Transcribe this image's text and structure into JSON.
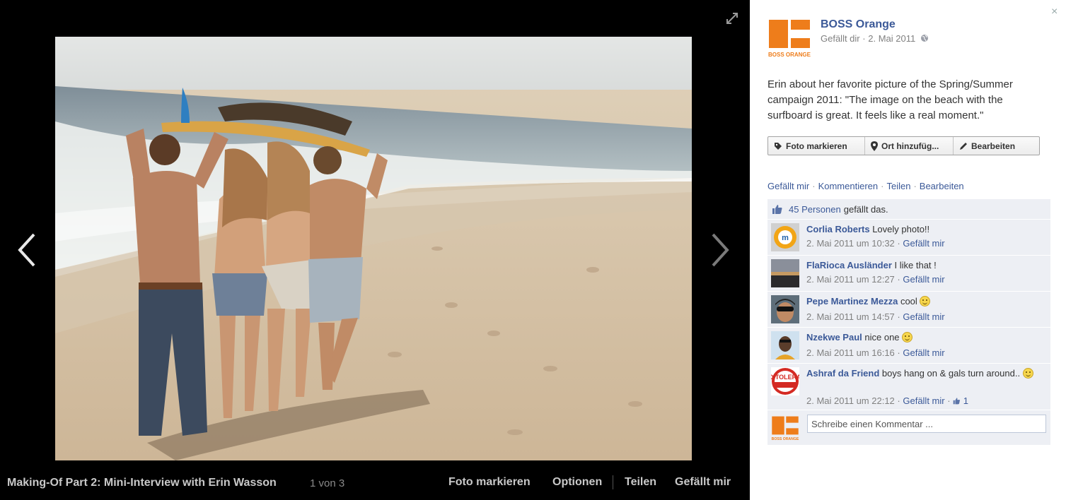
{
  "viewer": {
    "caption": "Making-Of Part 2: Mini-Interview with Erin Wasson",
    "counter": "1 von 3",
    "actions": {
      "tag": "Foto markieren",
      "options": "Optionen",
      "share": "Teilen",
      "like": "Gefällt mir"
    }
  },
  "sidebar": {
    "close": "×",
    "page": {
      "logo_text": "BOSS ORANGE",
      "name": "BOSS Orange",
      "likes_label": "Gefällt dir",
      "sep": "·",
      "date": "2. Mai 2011"
    },
    "description": "Erin about her favorite picture of the Spring/Summer campaign 2011: \"The image on the beach with the surfboard is great. It feels like a real moment.\"",
    "toolbar": {
      "tag": "Foto markieren",
      "location": "Ort hinzufüg...",
      "edit": "Bearbeiten"
    },
    "actions": {
      "like": "Gefällt mir",
      "comment": "Kommentieren",
      "share": "Teilen",
      "edit": "Bearbeiten",
      "sep": "·"
    },
    "likes": {
      "count": "45 Personen",
      "suffix": "gefällt das."
    },
    "comments": [
      {
        "author": "Corlia Roberts",
        "text": "Lovely photo!!",
        "time": "2. Mai 2011 um 10:32",
        "like": "Gefällt mir"
      },
      {
        "author": "FlaRioca Ausländer",
        "text": "I like that !",
        "time": "2. Mai 2011 um 12:27",
        "like": "Gefällt mir"
      },
      {
        "author": "Pepe Martinez Mezza",
        "text": "cool",
        "time": "2. Mai 2011 um 14:57",
        "like": "Gefällt mir",
        "smiley": true
      },
      {
        "author": "Nzekwe Paul",
        "text": "nice one",
        "time": "2. Mai 2011 um 16:16",
        "like": "Gefällt mir",
        "smiley": true
      },
      {
        "author": "Ashraf da Friend",
        "text": "boys hang on & gals turn around..",
        "time": "2. Mai 2011 um 22:12",
        "like": "Gefällt mir",
        "like_count": "1",
        "smiley": true,
        "avatar_text": "ZERO TOLERANCE"
      }
    ],
    "comment_input": {
      "placeholder": "Schreibe einen Kommentar ..."
    }
  },
  "colors": {
    "brand_orange": "#ee7d1b",
    "link_blue": "#3b5998",
    "comment_bg": "#edeff4"
  }
}
